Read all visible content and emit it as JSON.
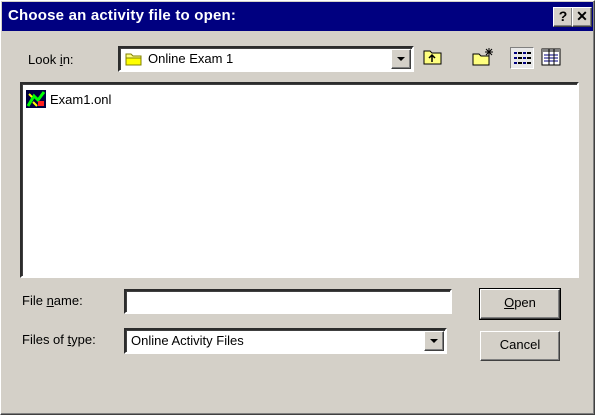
{
  "window": {
    "title": "Choose an activity file to open:",
    "help_button": "?",
    "close_button": "✕"
  },
  "look_in": {
    "label_pre": "Look ",
    "label_accel": "i",
    "label_post": "n:",
    "value": "Online Exam 1"
  },
  "toolbar": {
    "icons": [
      "up-one-level-icon",
      "create-new-folder-icon",
      "list-view-icon",
      "details-view-icon"
    ]
  },
  "files": [
    {
      "name": "Exam1.onl",
      "icon": "activity-file-icon"
    }
  ],
  "file_name": {
    "label_pre": "File ",
    "label_accel": "n",
    "label_post": "ame:",
    "value": ""
  },
  "file_type": {
    "label_pre": "Files of ",
    "label_accel": "t",
    "label_post": "ype:",
    "value": "Online Activity Files"
  },
  "buttons": {
    "open_accel": "O",
    "open_rest": "pen",
    "cancel": "Cancel"
  },
  "colors": {
    "titlebar": "#000080",
    "face": "#d4d0c8"
  }
}
